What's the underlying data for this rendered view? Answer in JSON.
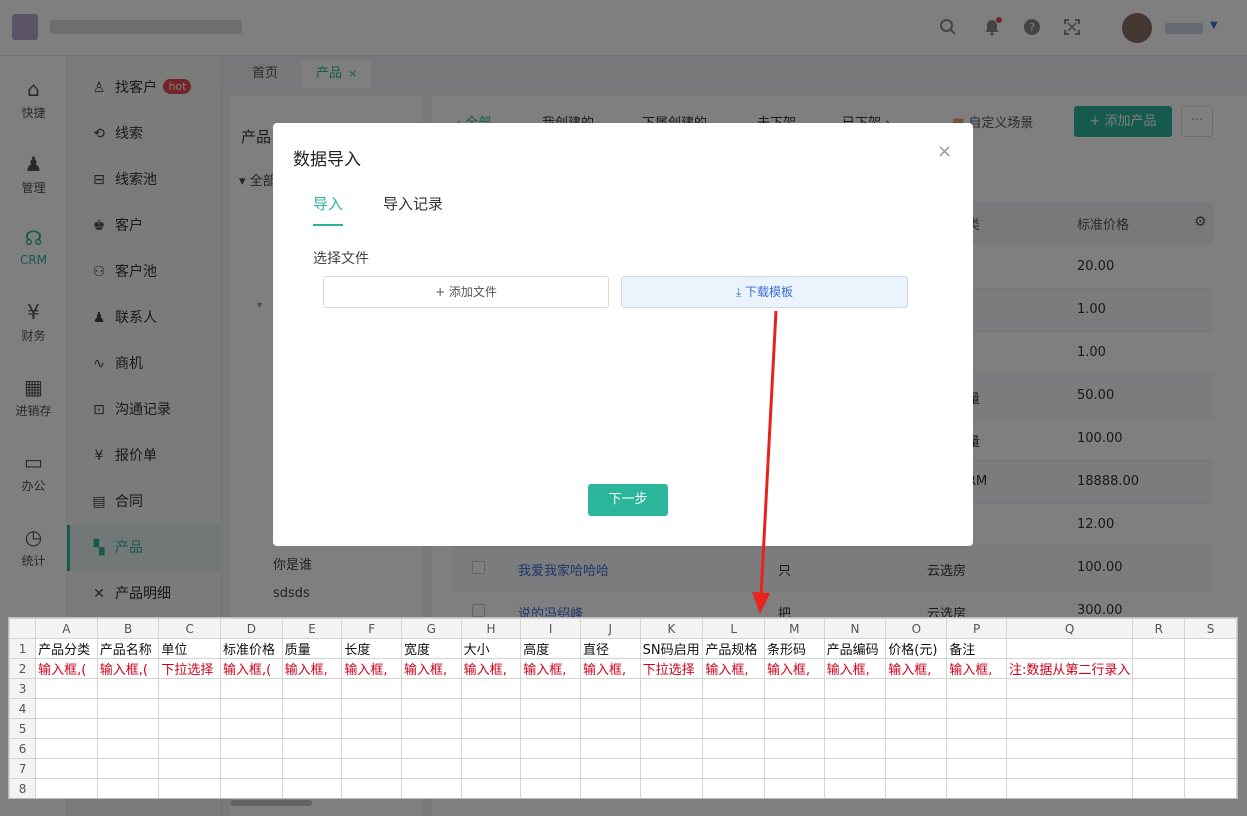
{
  "header": {
    "icons": [
      "search-icon",
      "bell-icon",
      "help-icon",
      "fullscreen-icon",
      "chevron-down-icon"
    ]
  },
  "rail": [
    {
      "label": "快捷",
      "icon": "home-icon"
    },
    {
      "label": "管理",
      "icon": "stamp-icon"
    },
    {
      "label": "CRM",
      "icon": "crm-icon"
    },
    {
      "label": "财务",
      "icon": "finance-icon"
    },
    {
      "label": "进销存",
      "icon": "warehouse-icon"
    },
    {
      "label": "办公",
      "icon": "monitor-icon"
    },
    {
      "label": "统计",
      "icon": "stats-icon"
    }
  ],
  "submenu": [
    {
      "label": "找客户",
      "badge": "hot"
    },
    {
      "label": "线索"
    },
    {
      "label": "线索池"
    },
    {
      "label": "客户"
    },
    {
      "label": "客户池"
    },
    {
      "label": "联系人"
    },
    {
      "label": "商机"
    },
    {
      "label": "沟通记录"
    },
    {
      "label": "报价单"
    },
    {
      "label": "合同"
    },
    {
      "label": "产品"
    },
    {
      "label": "产品明细"
    }
  ],
  "tabs": {
    "home": "首页",
    "product": "产品",
    "close": "×"
  },
  "leftpanel": {
    "title": "产品",
    "tree_all": "全部",
    "nodes": [
      "你是谁",
      "sdsds"
    ]
  },
  "rightpanel": {
    "scenes": [
      "全部",
      "我创建的",
      "下属创建的",
      "未下架",
      "已下架"
    ],
    "custom_scene": "自定义场景",
    "add_button": "添加产品",
    "more": "···",
    "headers": {
      "category": "类",
      "price": "标准价格"
    },
    "rows": [
      {
        "price": "20.00"
      },
      {
        "price": "1.00"
      },
      {
        "price": "1.00"
      },
      {
        "cat": "量",
        "price": "50.00"
      },
      {
        "cat": "量",
        "price": "100.00"
      },
      {
        "cat": "RM",
        "price": "18888.00"
      },
      {
        "price": "12.00"
      },
      {
        "name": "我爱我家哈哈哈",
        "unit": "只",
        "cat": "云选房",
        "price": "100.00"
      },
      {
        "name": "说的冯绍峰",
        "unit": "把",
        "cat": "云选房",
        "price": "300.00"
      }
    ]
  },
  "modal": {
    "title": "数据导入",
    "close": "×",
    "tab_import": "导入",
    "tab_records": "导入记录",
    "choose_file": "选择文件",
    "add_file": "+ 添加文件",
    "download_template": "⤓ 下载模板",
    "next": "下一步"
  },
  "sheet": {
    "columns": [
      "A",
      "B",
      "C",
      "D",
      "E",
      "F",
      "G",
      "H",
      "I",
      "J",
      "K",
      "L",
      "M",
      "N",
      "O",
      "P",
      "Q",
      "R",
      "S"
    ],
    "row_numbers": [
      "1",
      "2",
      "3",
      "4",
      "5",
      "6",
      "7",
      "8"
    ],
    "row1": [
      "产品分类",
      "产品名称",
      "单位",
      "标准价格",
      "质量",
      "长度",
      "宽度",
      "大小",
      "高度",
      "直径",
      "SN码启用",
      "产品规格",
      "条形码",
      "产品编码",
      "价格(元)",
      "备注",
      "",
      "",
      ""
    ],
    "row2": [
      "输入框,(",
      "输入框,(",
      "下拉选择",
      "输入框,(",
      "输入框,",
      "输入框,",
      "输入框,",
      "输入框,",
      "输入框,",
      "输入框,",
      "下拉选择",
      "输入框,",
      "输入框,",
      "输入框,",
      "输入框,",
      "输入框,",
      "注:数据从第二行录入",
      "",
      ""
    ]
  }
}
